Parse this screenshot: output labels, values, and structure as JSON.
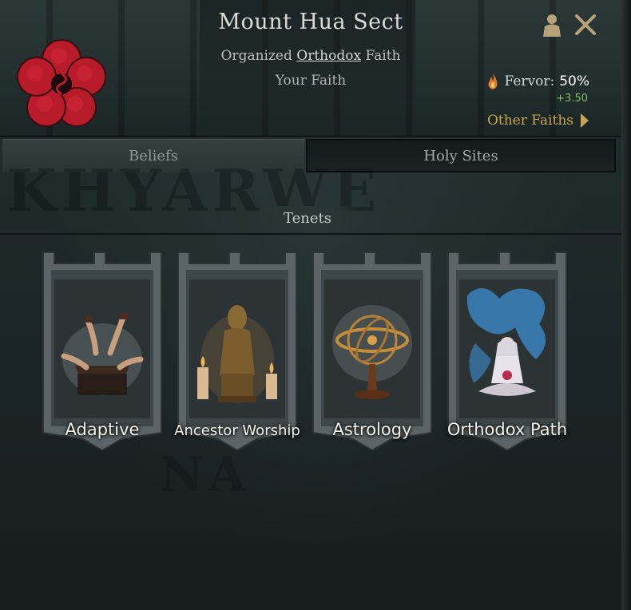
{
  "header": {
    "title": "Mount Hua Sect",
    "subtitle_prefix": "Organized",
    "subtitle_link": "Orthodox",
    "subtitle_suffix": "Faith",
    "your_faith": "Your Faith",
    "fervor_label": "Fervor:",
    "fervor_value": "50%",
    "fervor_change": "+3.50",
    "other_faiths": "Other Faiths",
    "emblem_color": "#c0202e"
  },
  "tabs": [
    {
      "label": "Beliefs",
      "active": true
    },
    {
      "label": "Holy Sites",
      "active": false
    }
  ],
  "section": {
    "label": "Tenets"
  },
  "tenets": [
    {
      "label": "Adaptive",
      "icon": "hands-on-chest-icon"
    },
    {
      "label": "Ancestor Worship",
      "icon": "ancestor-statue-icon"
    },
    {
      "label": "Astrology",
      "icon": "armillary-sphere-icon"
    },
    {
      "label": "Orthodox Path",
      "icon": "meditating-figure-icon"
    }
  ],
  "colors": {
    "accent_gold": "#c9a44c",
    "positive_green": "#7fbf5e",
    "fervor_flame": "#e07a2a"
  }
}
